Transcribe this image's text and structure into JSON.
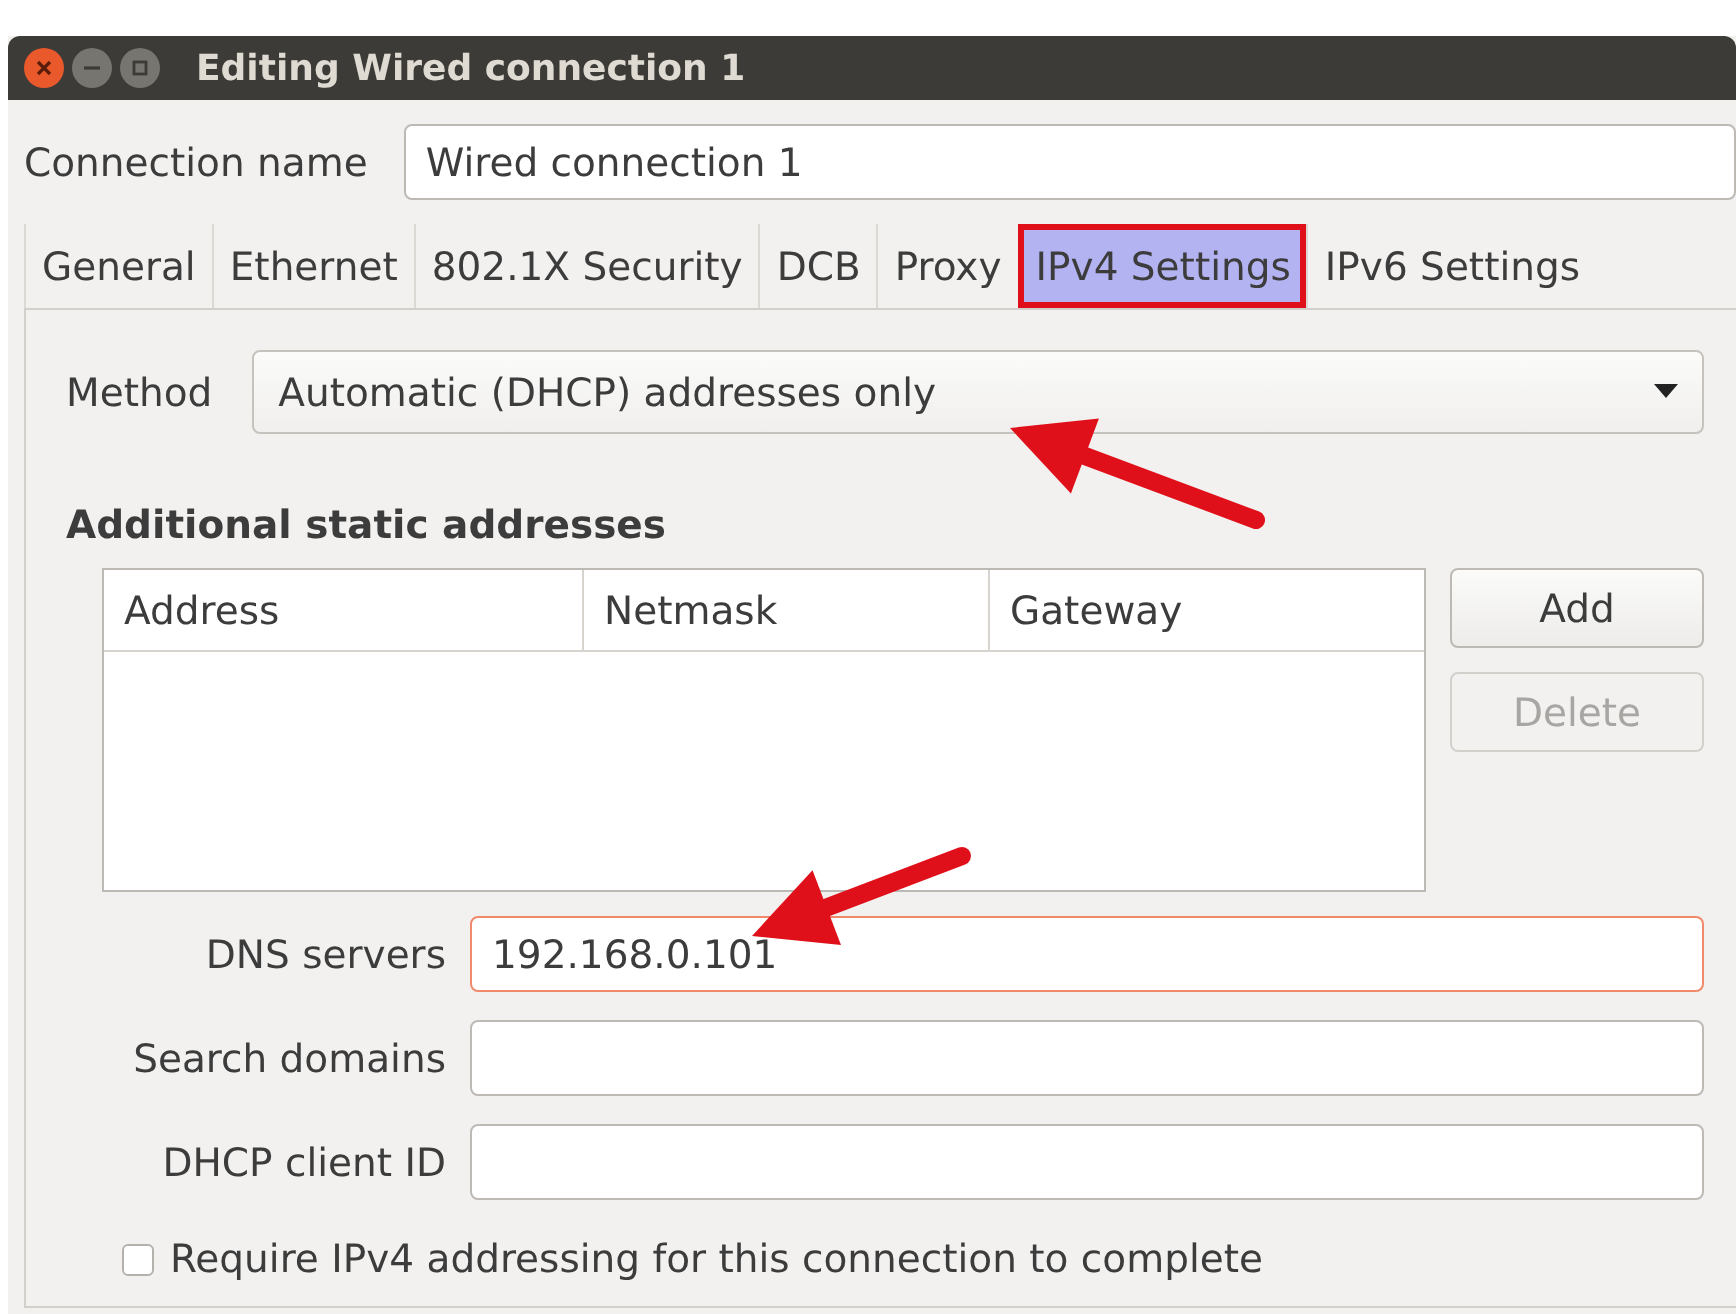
{
  "window": {
    "title": "Editing Wired connection 1"
  },
  "connection_name": {
    "label": "Connection name",
    "value": "Wired connection 1"
  },
  "tabs": [
    {
      "label": "General",
      "selected": false
    },
    {
      "label": "Ethernet",
      "selected": false
    },
    {
      "label": "802.1X Security",
      "selected": false
    },
    {
      "label": "DCB",
      "selected": false
    },
    {
      "label": "Proxy",
      "selected": false
    },
    {
      "label": "IPv4 Settings",
      "selected": true
    },
    {
      "label": "IPv6 Settings",
      "selected": false
    }
  ],
  "method": {
    "label": "Method",
    "value": "Automatic (DHCP) addresses only"
  },
  "static_addresses": {
    "heading": "Additional static addresses",
    "columns": [
      "Address",
      "Netmask",
      "Gateway"
    ]
  },
  "buttons": [
    {
      "label": "Add",
      "disabled": false
    },
    {
      "label": "Delete",
      "disabled": true
    }
  ],
  "fields": [
    {
      "label": "DNS servers",
      "value": "192.168.0.101",
      "focused": true
    },
    {
      "label": "Search domains",
      "focused": false
    },
    {
      "label": "DHCP client ID",
      "focused": false
    }
  ],
  "require_checkbox": {
    "label": "Require IPv4 addressing for this connection to complete",
    "checked": false
  }
}
